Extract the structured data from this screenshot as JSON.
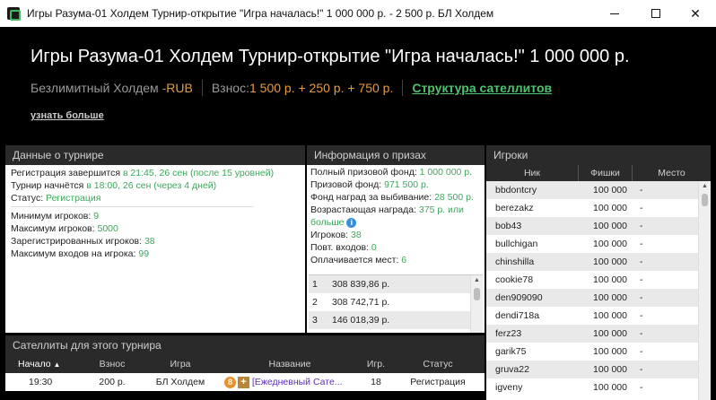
{
  "window": {
    "title": "Игры Разума-01 Холдем Турнир-открытие \"Игра началась!\" 1 000 000 р. - 2 500 р. БЛ Холдем"
  },
  "header": {
    "title": "Игры Разума-01 Холдем Турнир-открытие \"Игра началась!\" 1 000 000 р.",
    "game_type": "Безлимитный Холдем - ",
    "currency": "RUB",
    "buyin_label": "Взнос: ",
    "buyin_value": "1 500 р. + 250 р. + 750 р.",
    "satellite_link": "Структура сателлитов",
    "learn_more": "узнать больше"
  },
  "tournament": {
    "heading": "Данные о турнире",
    "reg_label": "Регистрация завершится ",
    "reg_value": "в 21:45, 26 сен (после 15 уровней)",
    "start_label": "Турнир начнётся ",
    "start_value": "в 18:00, 26 сен (через 4 дней)",
    "status_label": "Статус: ",
    "status_value": "Регистрация",
    "min_players_label": "Минимум игроков: ",
    "min_players_value": "9",
    "max_players_label": "Максимум игроков: ",
    "max_players_value": "5000",
    "registered_label": "Зарегистрированных игроков: ",
    "registered_value": "38",
    "max_entries_label": "Максимум входов на игрока: ",
    "max_entries_value": "99"
  },
  "prizes": {
    "heading": "Информация о призах",
    "total_label": "Полный призовой фонд: ",
    "total_value": "1 000 000 р.",
    "pool_label": "Призовой фонд: ",
    "pool_value": "971 500 р.",
    "bounty_fund_label": "Фонд наград за выбивание: ",
    "bounty_fund_value": "28 500 р.",
    "progressive_label": "Возрастающая награда: ",
    "progressive_value_1": "375 р. или",
    "progressive_value_2": "больше",
    "players_label": "Игроков: ",
    "players_value": "38",
    "reentries_label": "Повт. входов: ",
    "reentries_value": "0",
    "paid_label": "Оплачивается мест: ",
    "paid_value": "6",
    "payouts": [
      {
        "place": "1",
        "amount": "308 839,86 р."
      },
      {
        "place": "2",
        "amount": "308 742,71 р."
      },
      {
        "place": "3",
        "amount": "146 018,39 р."
      }
    ]
  },
  "players": {
    "heading": "Игроки",
    "col_nick": "Ник",
    "col_chips": "Фишки",
    "col_place": "Место",
    "rows": [
      {
        "nick": "bbdontcry",
        "chips": "100 000",
        "place": "-"
      },
      {
        "nick": "berezakz",
        "chips": "100 000",
        "place": "-"
      },
      {
        "nick": "bob43",
        "chips": "100 000",
        "place": "-"
      },
      {
        "nick": "bullchigan",
        "chips": "100 000",
        "place": "-"
      },
      {
        "nick": "chinshilla",
        "chips": "100 000",
        "place": "-"
      },
      {
        "nick": "cookie78",
        "chips": "100 000",
        "place": "-"
      },
      {
        "nick": "den909090",
        "chips": "100 000",
        "place": "-"
      },
      {
        "nick": "dendi718a",
        "chips": "100 000",
        "place": "-"
      },
      {
        "nick": "ferz23",
        "chips": "100 000",
        "place": "-"
      },
      {
        "nick": "garik75",
        "chips": "100 000",
        "place": "-"
      },
      {
        "nick": "gruva22",
        "chips": "100 000",
        "place": "-"
      },
      {
        "nick": "igveny",
        "chips": "100 000",
        "place": "-"
      }
    ]
  },
  "satellites": {
    "heading": "Сателлиты для этого турнира",
    "col_start": "Начало",
    "col_buyin": "Взнос",
    "col_game": "Игра",
    "col_name": "Название",
    "col_players": "Игр.",
    "col_status": "Статус",
    "rows": [
      {
        "start": "19:30",
        "buyin": "200 р.",
        "game": "БЛ Холдем",
        "badge": "8",
        "name": "[Ежедневный Сате...",
        "players": "18",
        "status": "Регистрация"
      }
    ]
  },
  "colors": {
    "accent_green": "#3aa85a",
    "accent_orange": "#e89b3c",
    "info_blue": "#3b8fd6"
  }
}
